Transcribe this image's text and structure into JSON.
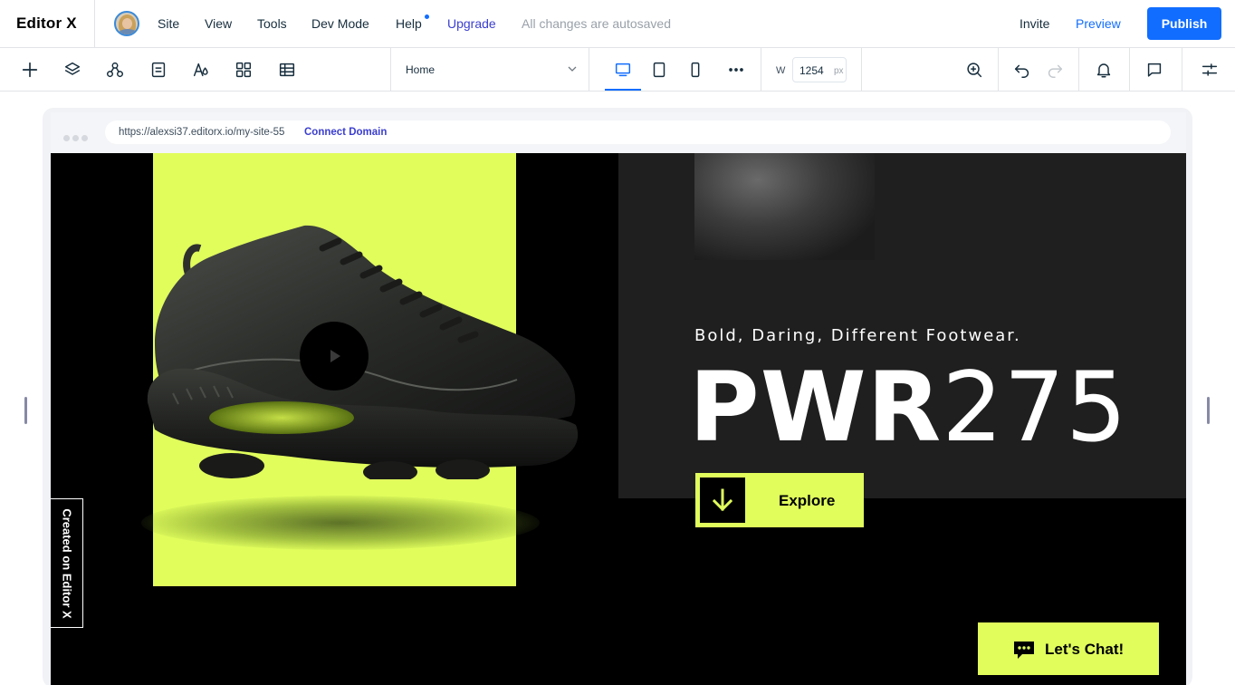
{
  "app": {
    "logo": "Editor X"
  },
  "menu": {
    "site": "Site",
    "view": "View",
    "tools": "Tools",
    "dev_mode": "Dev Mode",
    "help": "Help",
    "upgrade": "Upgrade",
    "autosave_status": "All changes are autosaved"
  },
  "header_actions": {
    "invite": "Invite",
    "preview": "Preview",
    "publish": "Publish"
  },
  "toolbar": {
    "page_selector": {
      "selected": "Home"
    },
    "width": {
      "label": "W",
      "value": "1254",
      "unit": "px"
    },
    "active_device": "desktop"
  },
  "browser": {
    "url": "https://alexsi37.editorx.io/my-site-55",
    "connect_domain": "Connect Domain"
  },
  "site": {
    "tagline": "Bold, Daring, Different Footwear.",
    "hero_title_bold": "PWR",
    "hero_title_light": "275",
    "explore_label": "Explore",
    "created_badge": "Created on Editor X",
    "chat_label": "Let's Chat!"
  },
  "colors": {
    "accent": "#116dff",
    "lime": "#e0fd5c",
    "dark_panel": "#1f1f1f",
    "upgrade": "#3b3ecf"
  }
}
